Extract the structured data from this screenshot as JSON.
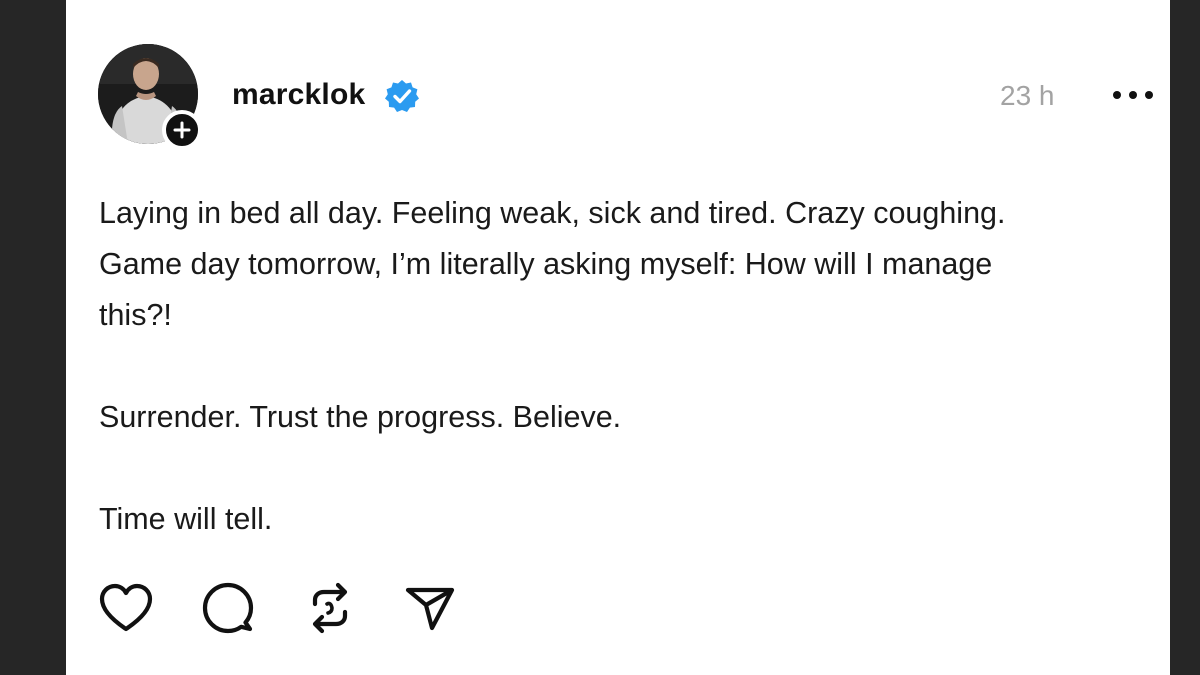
{
  "post": {
    "username": "marcklok",
    "verified": true,
    "timestamp": "23 h",
    "body": {
      "line1": "Laying in bed all day. Feeling weak, sick and tired. Crazy coughing.",
      "line2": "Game day tomorrow, I’m literally asking myself: How will I manage",
      "line3": "this?!",
      "line4": "Surrender. Trust the progress. Believe.",
      "line5": "Time will tell."
    }
  },
  "icons": {
    "avatar": "profile-photo",
    "follow": "plus-icon",
    "verified": "verified-badge-icon",
    "more": "more-horizontal-icon",
    "like": "heart-icon",
    "comment": "comment-bubble-icon",
    "repost": "repost-icon",
    "share": "send-icon"
  },
  "colors": {
    "card_background": "#ffffff",
    "page_background": "#262626",
    "text": "#1a1a1a",
    "muted_text": "#a3a3a3",
    "verified_blue": "#2b9bf0"
  }
}
